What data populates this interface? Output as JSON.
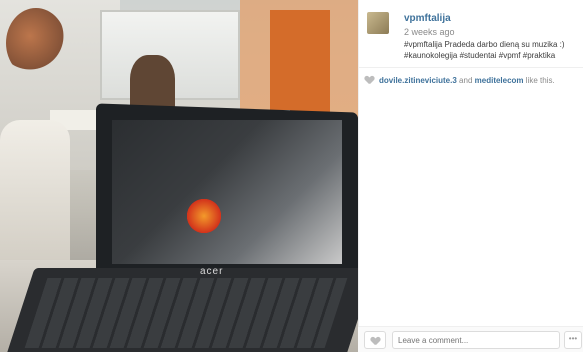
{
  "post": {
    "username": "vpmftalija",
    "time": "2 weeks ago",
    "caption": "#vpmftalija Pradeda darbo dieną su muzika :) #kaunokolegija #studentai #vpmf #praktika"
  },
  "photo": {
    "screen_brand": "acer"
  },
  "likes": {
    "user1": "dovile.zitineviciute.3",
    "connector": "and",
    "user2": "meditelecom",
    "suffix": "like this."
  },
  "comment": {
    "placeholder": "Leave a comment...",
    "more_label": "•••"
  },
  "colors": {
    "accent": "#3f729b",
    "meta": "#8a8a8a"
  }
}
